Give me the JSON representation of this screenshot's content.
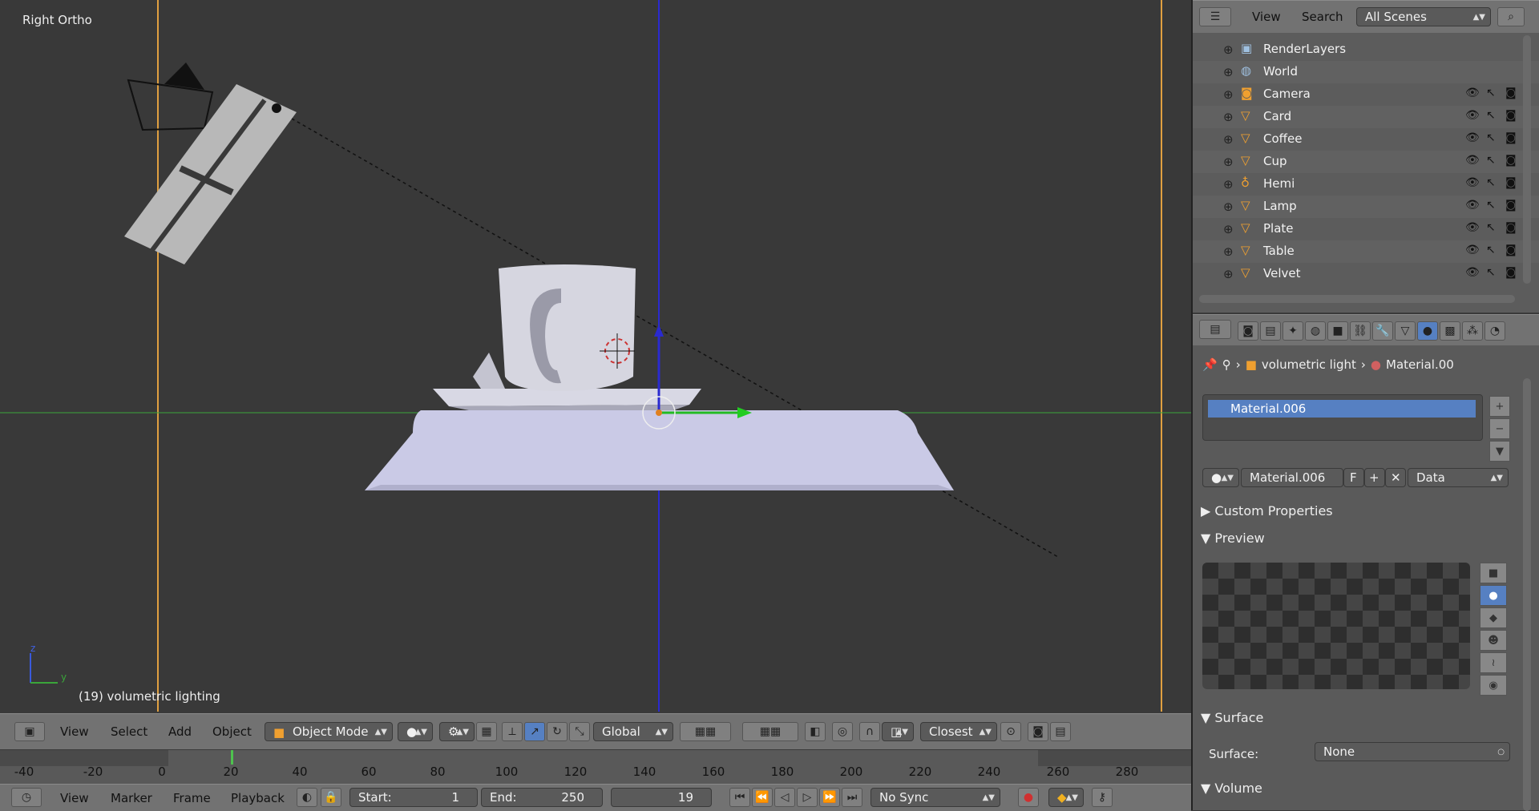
{
  "viewport": {
    "title": "Right Ortho",
    "status": "(19) volumetric lighting",
    "axis_z": "z",
    "axis_y": "y"
  },
  "header": {
    "menu": [
      "View",
      "Select",
      "Add",
      "Object"
    ],
    "mode": "Object Mode",
    "orientation": "Global",
    "snap": "Closest"
  },
  "timeline": {
    "ticks": [
      "-40",
      "-20",
      "0",
      "20",
      "40",
      "60",
      "80",
      "100",
      "120",
      "140",
      "160",
      "180",
      "200",
      "220",
      "240",
      "260",
      "280"
    ],
    "current_frame_marker": 19
  },
  "playback_bar": {
    "menu": [
      "View",
      "Marker",
      "Frame",
      "Playback"
    ],
    "start_label": "Start:",
    "start_value": "1",
    "end_label": "End:",
    "end_value": "250",
    "current_frame": "19",
    "sync": "No Sync"
  },
  "outliner": {
    "menu": [
      "View",
      "Search"
    ],
    "scene_filter": "All Scenes",
    "items": [
      {
        "name": "RenderLayers",
        "icon": "render-layers-icon"
      },
      {
        "name": "World",
        "icon": "world-icon"
      },
      {
        "name": "Camera",
        "icon": "camera-icon"
      },
      {
        "name": "Card",
        "icon": "mesh-icon"
      },
      {
        "name": "Coffee",
        "icon": "mesh-icon"
      },
      {
        "name": "Cup",
        "icon": "mesh-icon"
      },
      {
        "name": "Hemi",
        "icon": "lamp-icon"
      },
      {
        "name": "Lamp",
        "icon": "mesh-icon"
      },
      {
        "name": "Plate",
        "icon": "mesh-icon"
      },
      {
        "name": "Table",
        "icon": "mesh-icon"
      },
      {
        "name": "Velvet",
        "icon": "mesh-icon"
      }
    ]
  },
  "properties": {
    "breadcrumb_object": "volumetric light",
    "breadcrumb_material": "Material.00",
    "slot_selected": "Material.006",
    "material_name": "Material.006",
    "fake_user": "F",
    "link_mode": "Data",
    "sections": {
      "custom_props": "Custom Properties",
      "preview": "Preview",
      "surface": "Surface",
      "volume": "Volume"
    },
    "surface_label": "Surface:",
    "surface_value": "None"
  },
  "colors": {
    "accent_blue": "#5680c2",
    "bg_viewport": "#393939",
    "axis_green": "#3aa53a",
    "axis_blue": "#2a2ad0",
    "frame_line": "#e0a040"
  }
}
